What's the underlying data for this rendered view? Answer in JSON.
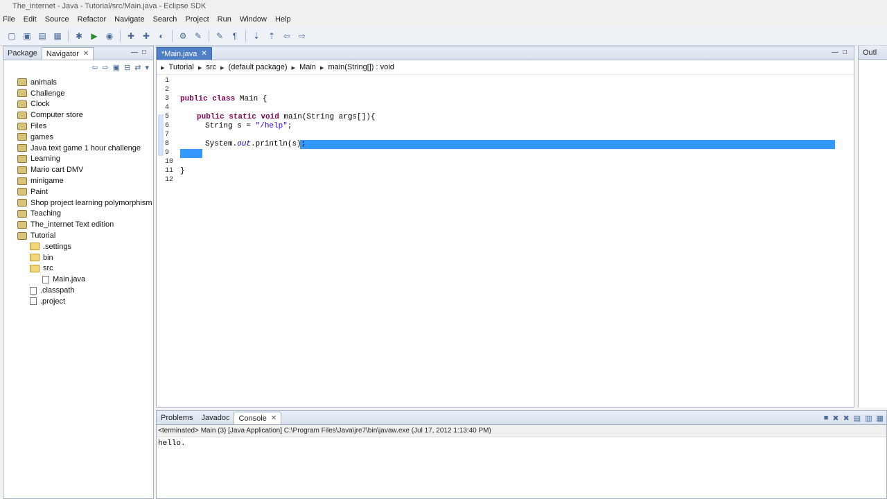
{
  "window": {
    "title": "The_internet - Java - Tutorial/src/Main.java - Eclipse SDK"
  },
  "menu": [
    "File",
    "Edit",
    "Source",
    "Refactor",
    "Navigate",
    "Search",
    "Project",
    "Run",
    "Window",
    "Help"
  ],
  "left_panel": {
    "tabs": [
      {
        "label": "Package"
      },
      {
        "label": "Navigator"
      }
    ],
    "tree": [
      {
        "label": "animals",
        "type": "project"
      },
      {
        "label": "Challenge",
        "type": "project"
      },
      {
        "label": "Clock",
        "type": "project"
      },
      {
        "label": "Computer store",
        "type": "project"
      },
      {
        "label": "Files",
        "type": "project"
      },
      {
        "label": "games",
        "type": "project"
      },
      {
        "label": "Java text game 1 hour challenge",
        "type": "project"
      },
      {
        "label": "Learning",
        "type": "project"
      },
      {
        "label": "Mario cart DMV",
        "type": "project"
      },
      {
        "label": "minigame",
        "type": "project"
      },
      {
        "label": "Paint",
        "type": "project"
      },
      {
        "label": "Shop project learning polymorphism",
        "type": "project"
      },
      {
        "label": "Teaching",
        "type": "project"
      },
      {
        "label": "The_internet Text edition",
        "type": "project"
      },
      {
        "label": "Tutorial",
        "type": "project"
      },
      {
        "label": ".settings",
        "type": "folder"
      },
      {
        "label": "bin",
        "type": "folder"
      },
      {
        "label": "src",
        "type": "folder"
      },
      {
        "label": "Main.java",
        "type": "file"
      },
      {
        "label": ".classpath",
        "type": "file"
      },
      {
        "label": ".project",
        "type": "file"
      }
    ]
  },
  "editor": {
    "tab_label": "*Main.java",
    "breadcrumb": [
      "Tutorial",
      "src",
      "(default package)",
      "Main",
      "main(String[]) : void"
    ],
    "line_numbers": [
      "1",
      "2",
      "3",
      "4",
      "5",
      "6",
      "7",
      "8",
      "9",
      "10",
      "11",
      "12"
    ],
    "code": {
      "line3_kw": "public class",
      "line3_rest": " Main {",
      "line5_kw": "public static void",
      "line5_rest": " main(String args[]){",
      "line6_a": "String s = ",
      "line6_str": "\"/help\"",
      "line6_b": ";",
      "line8_a": "System.",
      "line8_out": "out",
      "line8_b": ".println(s);",
      "line11": "}"
    }
  },
  "outline": {
    "tab_label": "Outl"
  },
  "bottom_panel": {
    "tabs": [
      {
        "label": "Problems"
      },
      {
        "label": "Javadoc"
      },
      {
        "label": "Console"
      }
    ],
    "status": "<terminated> Main (3) [Java Application] C:\\Program Files\\Java\\jre7\\bin\\javaw.exe (Jul 17, 2012 1:13:40 PM)",
    "output": "hello."
  }
}
